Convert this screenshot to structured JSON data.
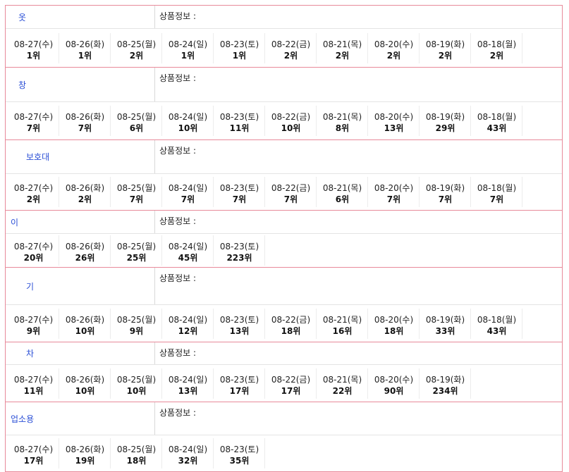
{
  "info_label": "상품정보 :",
  "groups": [
    {
      "keyword": "옷",
      "hh": 32,
      "rh": 54,
      "indent": 18,
      "dates": [
        "08-27(수)",
        "08-26(화)",
        "08-25(월)",
        "08-24(일)",
        "08-23(토)",
        "08-22(금)",
        "08-21(목)",
        "08-20(수)",
        "08-19(화)",
        "08-18(월)"
      ],
      "ranks": [
        "1위",
        "1위",
        "2위",
        "1위",
        "1위",
        "2위",
        "2위",
        "2위",
        "2위",
        "2위"
      ]
    },
    {
      "keyword": "창",
      "hh": 48,
      "rh": 53,
      "indent": 18,
      "dates": [
        "08-27(수)",
        "08-26(화)",
        "08-25(월)",
        "08-24(일)",
        "08-23(토)",
        "08-22(금)",
        "08-21(목)",
        "08-20(수)",
        "08-19(화)",
        "08-18(월)"
      ],
      "ranks": [
        "7위",
        "7위",
        "6위",
        "10위",
        "11위",
        "10위",
        "8위",
        "13위",
        "29위",
        "43위"
      ]
    },
    {
      "keyword": "보호대",
      "hh": 47,
      "rh": 51,
      "indent": 29,
      "dates": [
        "08-27(수)",
        "08-26(화)",
        "08-25(월)",
        "08-24(일)",
        "08-23(토)",
        "08-22(금)",
        "08-21(목)",
        "08-20(수)",
        "08-19(화)",
        "08-18(월)"
      ],
      "ranks": [
        "2위",
        "2위",
        "7위",
        "7위",
        "7위",
        "7위",
        "6위",
        "7위",
        "7위",
        "7위"
      ]
    },
    {
      "keyword": "이",
      "hh": 32,
      "rh": 47,
      "indent": 7,
      "dates": [
        "08-27(수)",
        "08-26(화)",
        "08-25(월)",
        "08-24(일)",
        "08-23(토)"
      ],
      "ranks": [
        "20위",
        "26위",
        "25위",
        "45위",
        "223위"
      ]
    },
    {
      "keyword": "기",
      "hh": 52,
      "rh": 52,
      "indent": 29,
      "dates": [
        "08-27(수)",
        "08-26(화)",
        "08-25(월)",
        "08-24(일)",
        "08-23(토)",
        "08-22(금)",
        "08-21(목)",
        "08-20(수)",
        "08-19(화)",
        "08-18(월)"
      ],
      "ranks": [
        "9위",
        "10위",
        "9위",
        "12위",
        "13위",
        "18위",
        "16위",
        "18위",
        "33위",
        "43위"
      ]
    },
    {
      "keyword": "차",
      "hh": 31,
      "rh": 52,
      "indent": 29,
      "dates": [
        "08-27(수)",
        "08-26(화)",
        "08-25(월)",
        "08-24(일)",
        "08-23(토)",
        "08-22(금)",
        "08-21(목)",
        "08-20(수)",
        "08-19(화)"
      ],
      "ranks": [
        "11위",
        "10위",
        "10위",
        "13위",
        "17위",
        "17위",
        "22위",
        "90위",
        "234위"
      ]
    },
    {
      "keyword": "업소용",
      "hh": 46,
      "rh": 51,
      "indent": 7,
      "dates": [
        "08-27(수)",
        "08-26(화)",
        "08-25(월)",
        "08-24(일)",
        "08-23(토)"
      ],
      "ranks": [
        "17위",
        "19위",
        "18위",
        "32위",
        "35위"
      ]
    }
  ]
}
